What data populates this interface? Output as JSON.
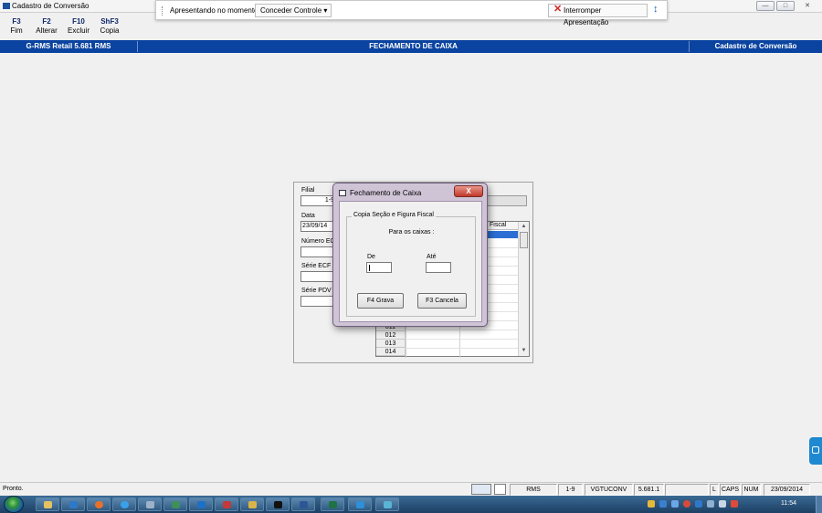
{
  "window": {
    "title": "Cadastro de Conversão"
  },
  "toolbar": {
    "keys": [
      {
        "key": "F3",
        "label": "Fim"
      },
      {
        "key": "F2",
        "label": "Alterar"
      },
      {
        "key": "F10",
        "label": "Excluir"
      },
      {
        "key": "ShF3",
        "label": "Copia"
      }
    ]
  },
  "share": {
    "presenting": "Apresentando no momento",
    "control": "Conceder Controle",
    "stop": "Interromper Apresentação"
  },
  "header": {
    "left": "G-RMS Retail 5.681 RMS",
    "center": "FECHAMENTO DE CAIXA",
    "right": "Cadastro de Conversão"
  },
  "form": {
    "filial_label": "Filial",
    "filial_value": "1-9",
    "data_label": "Data",
    "data_value": "23/09/14",
    "numero_ecf_label": "Número ECF",
    "serie_ecf_label": "Série ECF",
    "serie_pdv_label": "Série PDV"
  },
  "grid": {
    "col_fiscal": "Fiscal",
    "rows": [
      "011",
      "012",
      "013",
      "014"
    ]
  },
  "dialog": {
    "title": "Fechamento de Caixa",
    "close": "X",
    "group_label": "Copia Seção e Figura Fiscal",
    "para": "Para os caixas :",
    "de_label": "De",
    "ate_label": "Até",
    "grava_button": "F4 Grava",
    "cancela_button": "F3 Cancela"
  },
  "status": {
    "message": "Pronto.",
    "rms": "RMS",
    "filial": "1-9",
    "program": "VGTUCONV",
    "version": "5.681.1",
    "l": "L",
    "caps": "CAPS",
    "num": "NUM",
    "date": "23/09/2014"
  },
  "taskbar": {
    "clock": "11:54"
  }
}
